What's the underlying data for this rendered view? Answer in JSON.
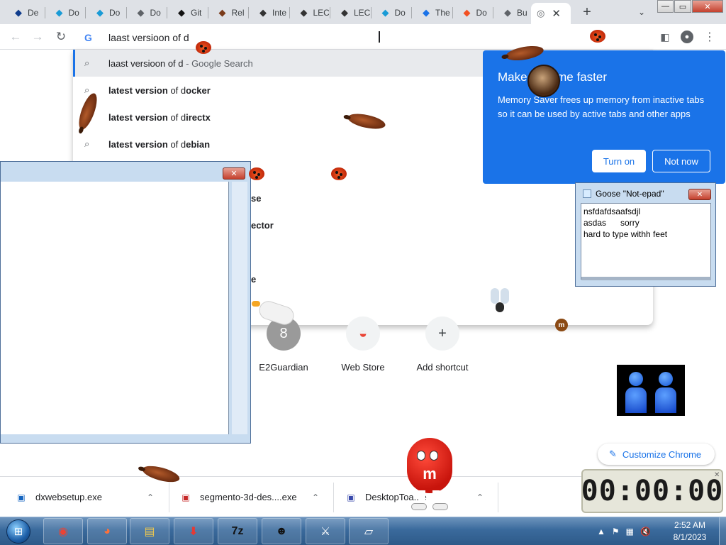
{
  "tabs": [
    {
      "label": "De",
      "icon": "s-letter-icon",
      "color": "#0f3c8c"
    },
    {
      "label": "Do",
      "icon": "down-arrow-logo-icon",
      "color": "#1a9bd6"
    },
    {
      "label": "Do",
      "icon": "down-arrow-logo-icon",
      "color": "#1a9bd6"
    },
    {
      "label": "Do",
      "icon": "globe-icon",
      "color": "#5f6368"
    },
    {
      "label": "Git",
      "icon": "github-icon",
      "color": "#111111"
    },
    {
      "label": "Rel",
      "icon": "app-icon",
      "color": "#7a3b1a"
    },
    {
      "label": "Inte",
      "icon": "institution-icon",
      "color": "#333333"
    },
    {
      "label": "LEC",
      "icon": "institution-icon",
      "color": "#333333"
    },
    {
      "label": "LEC",
      "icon": "institution-icon",
      "color": "#333333"
    },
    {
      "label": "Do",
      "icon": "down-arrow-logo-icon",
      "color": "#1a9bd6"
    },
    {
      "label": "The",
      "icon": "bing-icon",
      "color": "#1a73e8"
    },
    {
      "label": "Do",
      "icon": "microsoft-icon",
      "color": "#f25022"
    },
    {
      "label": "Bu",
      "icon": "globe-icon",
      "color": "#5f6368"
    }
  ],
  "active_tab": {
    "icon": "chrome-icon",
    "close": "✕"
  },
  "tab_controls": {
    "new_tab": "+",
    "tab_search": "⌄"
  },
  "window_controls": {
    "minimize": "—",
    "maximize": "▭",
    "close": "✕"
  },
  "omnibox": {
    "text": "laast versioon  of  d",
    "search_engine_icon": "G"
  },
  "suggestions": [
    {
      "bold": "",
      "text": "laast versioon of d",
      "dim": " - Google Search",
      "selected": true
    },
    {
      "bold": "latest version",
      "text": " of d",
      "bold2": "ocker"
    },
    {
      "bold": "latest version",
      "text": " of d",
      "bold2": "irectx"
    },
    {
      "bold": "latest version",
      "text": " of d",
      "bold2": "ebian"
    }
  ],
  "hidden_suggestion_fragments": [
    "se",
    "ector",
    "e"
  ],
  "promo": {
    "title": "Make Chrome faster",
    "body": "Memory Saver frees up memory from inactive tabs so it can be used by active tabs and other apps",
    "turn_on": "Turn on",
    "not_now": "Not now"
  },
  "shortcuts": [
    {
      "label": "E2Guardian",
      "glyph": "8"
    },
    {
      "label": "Web Store",
      "glyph": "◒"
    },
    {
      "label": "Add shortcut",
      "glyph": "+"
    }
  ],
  "customize": {
    "label": "Customize Chrome",
    "icon": "✎"
  },
  "goose_notepad": {
    "title": "Goose \"Not-epad\"",
    "lines": [
      "nsfdafdsaafsdjl",
      "asdas      sorry",
      "hard to type withh feet"
    ]
  },
  "timer": {
    "value": "00:00:00"
  },
  "downloads": [
    {
      "name": "dxwebsetup.exe",
      "icon_color": "#1565c0"
    },
    {
      "name": "segmento-3d-des....exe",
      "icon_color": "#c62828"
    },
    {
      "name": "DesktopToa...e",
      "icon_color": "#3949ab"
    }
  ],
  "taskbar": {
    "apps": [
      {
        "name": "chrome",
        "glyph": "◉",
        "color": "#ea4335"
      },
      {
        "name": "firefox",
        "glyph": "◕",
        "color": "#ff7139"
      },
      {
        "name": "file-explorer",
        "glyph": "▤",
        "color": "#f2c94c"
      },
      {
        "name": "downloader",
        "glyph": "⬇",
        "color": "#e53935"
      },
      {
        "name": "7zip",
        "glyph": "7z",
        "color": "#111111"
      },
      {
        "name": "penguin-app",
        "glyph": "☻",
        "color": "#111111"
      },
      {
        "name": "sword-app",
        "glyph": "⚔",
        "color": "#ffffff"
      },
      {
        "name": "notepad",
        "glyph": "▱",
        "color": "#ffffff"
      }
    ],
    "tray_icons": [
      "▲",
      "⚑",
      "▦",
      "🔇"
    ],
    "time": "2:52 AM",
    "date": "8/1/2023"
  }
}
